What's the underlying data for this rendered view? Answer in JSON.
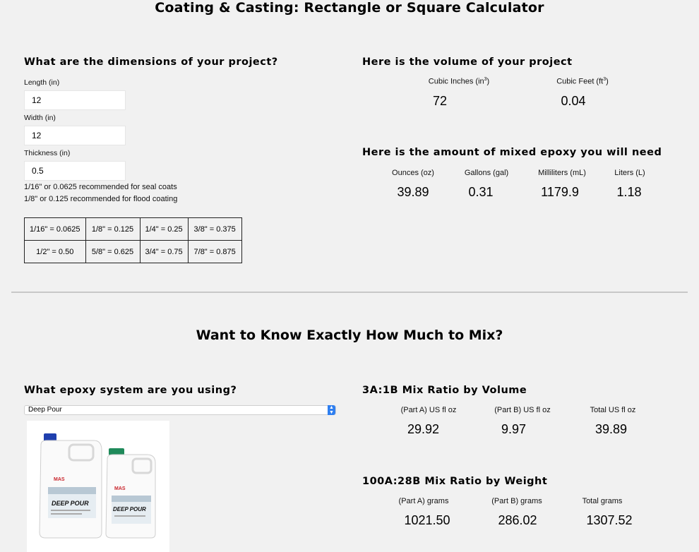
{
  "page_title": "Coating & Casting: Rectangle or Square Calculator",
  "dimensions": {
    "heading": "What are the dimensions of your project?",
    "length_label": "Length (in)",
    "length_value": "12",
    "width_label": "Width (in)",
    "width_value": "12",
    "thickness_label": "Thickness (in)",
    "thickness_value": "0.5",
    "note_seal": "1/16\" or 0.0625 recommended for seal coats",
    "note_flood": "1/8\" or 0.125 recommended for flood coating"
  },
  "conversion_table": [
    [
      "1/16\" = 0.0625",
      "1/8\" = 0.125",
      "1/4\" = 0.25",
      "3/8\" = 0.375"
    ],
    [
      "1/2\" = 0.50",
      "5/8\" = 0.625",
      "3/4\" = 0.75",
      "7/8\" = 0.875"
    ]
  ],
  "volume": {
    "heading": "Here is the volume of your project",
    "cubic_inches_label": "Cubic Inches (in",
    "cubic_inches_sup": "3",
    "cubic_inches_value": "72",
    "cubic_feet_label": "Cubic Feet (ft",
    "cubic_feet_sup": "3",
    "cubic_feet_value": "0.04"
  },
  "mixed": {
    "heading": "Here is the amount of mixed epoxy you will need",
    "columns": [
      {
        "label": "Ounces (oz)",
        "value": "39.89"
      },
      {
        "label": "Gallons (gal)",
        "value": "0.31"
      },
      {
        "label": "Milliliters (mL)",
        "value": "1179.9"
      },
      {
        "label": "Liters (L)",
        "value": "1.18"
      }
    ]
  },
  "mix_section_title": "Want to Know Exactly How Much to Mix?",
  "epoxy": {
    "heading": "What epoxy system are you using?",
    "selected": "Deep Pour",
    "bottle_brand": "MAS",
    "bottle_label": "DEEP POUR"
  },
  "volume_ratio": {
    "heading": "3A:1B Mix Ratio by Volume",
    "columns": [
      {
        "label": "(Part A) US fl oz",
        "value": "29.92"
      },
      {
        "label": "(Part B) US fl oz",
        "value": "9.97"
      },
      {
        "label": "Total US fl oz",
        "value": "39.89"
      }
    ]
  },
  "weight_ratio": {
    "heading": "100A:28B Mix Ratio by Weight",
    "columns": [
      {
        "label": "(Part A) grams",
        "value": "1021.50"
      },
      {
        "label": "(Part B) grams",
        "value": "286.02"
      },
      {
        "label": "Total grams",
        "value": "1307.52"
      }
    ]
  },
  "colors": {
    "background": "#f1f1f1",
    "select_arrow": "#2f7ff0",
    "cap_blue": "#1f3fae",
    "cap_green": "#1f8a5a"
  }
}
